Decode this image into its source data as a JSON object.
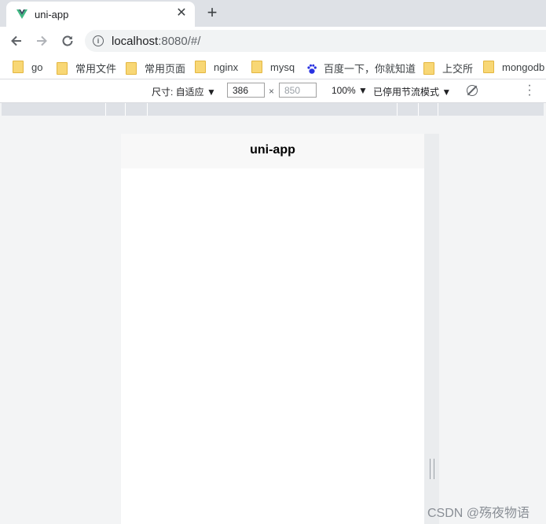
{
  "tab": {
    "title": "uni-app",
    "close_icon": "close-icon",
    "new_tab_icon": "plus-icon",
    "favicon": "vue-logo-icon"
  },
  "toolbar": {
    "back_icon": "arrow-left-icon",
    "forward_icon": "arrow-right-icon",
    "reload_icon": "reload-icon"
  },
  "address": {
    "host": "localhost",
    "path": ":8080/#/"
  },
  "bookmarks": [
    {
      "label": "go",
      "icon": "folder-icon"
    },
    {
      "label": "常用文件",
      "icon": "folder-icon"
    },
    {
      "label": "常用页面",
      "icon": "folder-icon"
    },
    {
      "label": "nginx",
      "icon": "folder-icon"
    },
    {
      "label": "mysq",
      "icon": "folder-icon"
    },
    {
      "label": "百度一下，你就知道",
      "icon": "baidu-paw-icon"
    },
    {
      "label": "上交所",
      "icon": "folder-icon"
    },
    {
      "label": "mongodb",
      "icon": "folder-icon"
    }
  ],
  "device_toolbar": {
    "size_label": "尺寸: 自适应 ▼",
    "width": "386",
    "times": "×",
    "height_placeholder": "850",
    "zoom": "100% ▼",
    "throttle": "已停用节流模式 ▼"
  },
  "app": {
    "nav_title": "uni-app"
  },
  "watermark": "CSDN @殇夜物语",
  "colors": {
    "tab_strip": "#dee1e6",
    "folder": "#f8d775",
    "vue_green": "#41b883",
    "vue_dark": "#35495e",
    "baidu_blue": "#2932e1"
  }
}
